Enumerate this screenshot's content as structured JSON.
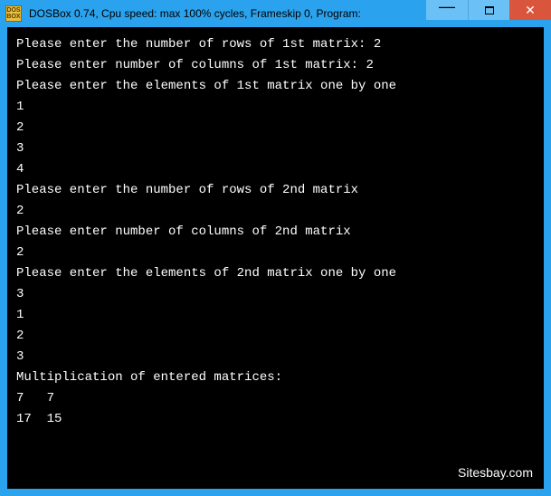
{
  "titlebar": {
    "icon_label": "DOS\nBOX",
    "title": "DOSBox 0.74, Cpu speed: max 100% cycles, Frameskip  0, Program:"
  },
  "console": {
    "lines": [
      "Please enter the number of rows of 1st matrix: 2",
      "Please enter number of columns of 1st matrix: 2",
      "Please enter the elements of 1st matrix one by one",
      "1",
      "2",
      "3",
      "4",
      "Please enter the number of rows of 2nd matrix",
      "2",
      "Please enter number of columns of 2nd matrix",
      "2",
      "Please enter the elements of 2nd matrix one by one",
      "3",
      "1",
      "2",
      "3",
      "Multiplication of entered matrices:",
      "7   7",
      "17  15"
    ]
  },
  "watermark": "Sitesbay.com"
}
